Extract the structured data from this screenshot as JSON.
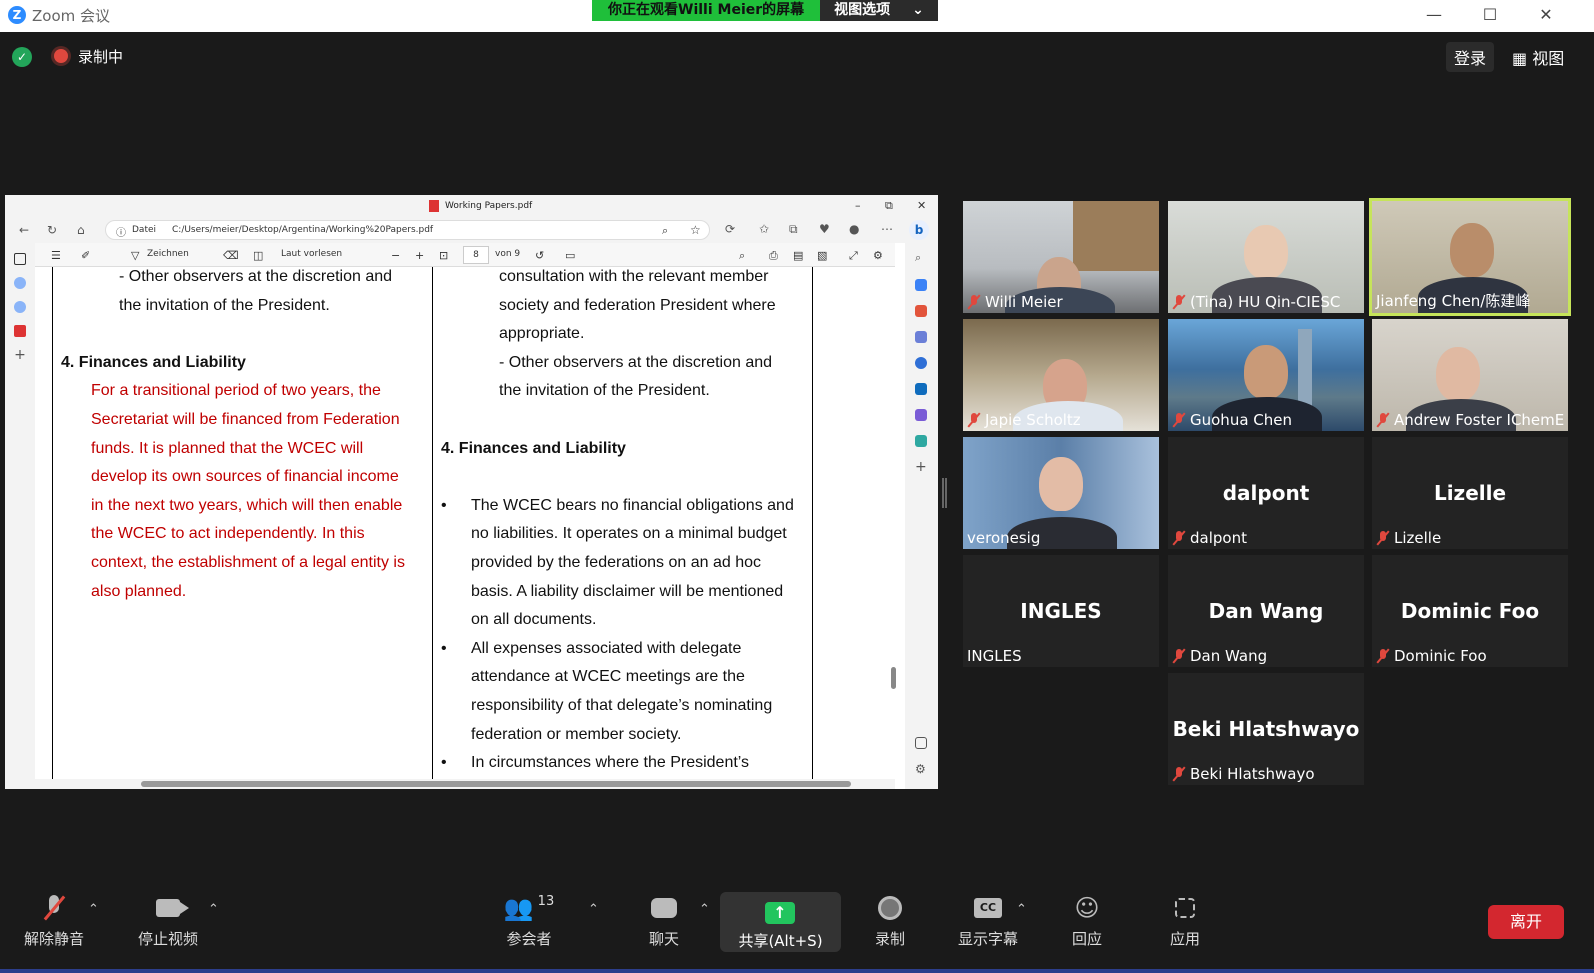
{
  "window": {
    "app_title": "Zoom 会议",
    "minimize": "—",
    "maximize": "☐",
    "close": "✕"
  },
  "share_banner": {
    "viewing_text": "你正在观看Willi  Meier的屏幕",
    "view_options": "视图选项",
    "chevron": "⌄"
  },
  "topbar": {
    "recording_label": "录制中",
    "login": "登录",
    "view": "视图"
  },
  "browser": {
    "tab_title": "Working Papers.pdf",
    "datei": "Datei",
    "url": "C:/Users/meier/Desktop/Argentina/Working%20Papers.pdf",
    "zeichnen": "Zeichnen",
    "laut_vorlesen": "Laut vorlesen",
    "page_current": "8",
    "page_total": "von 9"
  },
  "document": {
    "left_col": {
      "line1": "- Other observers at the discretion and",
      "line2": "the invitation of the President.",
      "heading": "4. Finances and Liability",
      "red_lines": [
        "For a transitional period of two years, the",
        "Secretariat will be financed from Federation",
        "funds. It is planned that the WCEC will",
        "develop its own sources of financial income",
        "in the next two years, which will then enable",
        "the WCEC to act independently. In this",
        "context, the establishment of a legal entity is",
        "also planned."
      ]
    },
    "right_col": {
      "top_lines": [
        "consultation with the relevant member",
        "society and federation President where",
        "appropriate.",
        "- Other observers at the discretion and",
        "the invitation of the President."
      ],
      "heading": "4. Finances and Liability",
      "bullet1": [
        "The WCEC bears no financial obligations and",
        "no liabilities.  It operates on a minimal budget",
        "provided by the federations on an ad hoc",
        "basis.  A liability disclaimer will be mentioned",
        "on all documents."
      ],
      "bullet2": [
        "All expenses associated with delegate",
        "attendance at WCEC meetings are the",
        "responsibility of that delegate’s nominating",
        "federation or member society."
      ],
      "bullet3": [
        "In circumstances where the President’s"
      ],
      "bullet_glyph": "•"
    }
  },
  "participants": [
    {
      "name": "Willi Meier",
      "muted": true,
      "video": true,
      "active": false
    },
    {
      "name": "(Tina) HU Qin-CIESC",
      "muted": true,
      "video": true,
      "active": false
    },
    {
      "name": "Jianfeng Chen/陈建峰",
      "muted": false,
      "video": true,
      "active": true
    },
    {
      "name": "Japie Scholtz",
      "muted": true,
      "video": true,
      "active": false
    },
    {
      "name": "Guohua Chen",
      "muted": true,
      "video": true,
      "active": false
    },
    {
      "name": "Andrew Foster IChemE",
      "muted": true,
      "video": true,
      "active": false
    },
    {
      "name": "veronesig",
      "muted": false,
      "video": true,
      "active": false
    },
    {
      "name": "dalpont",
      "big": "dalpont",
      "muted": true,
      "video": false,
      "active": false
    },
    {
      "name": "Lizelle",
      "big": "Lizelle",
      "muted": true,
      "video": false,
      "active": false
    },
    {
      "name": "INGLES",
      "big": "INGLES",
      "muted": false,
      "video": false,
      "active": false
    },
    {
      "name": "Dan Wang",
      "big": "Dan Wang",
      "muted": true,
      "video": false,
      "active": false
    },
    {
      "name": "Dominic Foo",
      "big": "Dominic Foo",
      "muted": true,
      "video": false,
      "active": false
    },
    {
      "name": "Beki Hlatshwayo",
      "big": "Beki Hlatshwayo",
      "muted": true,
      "video": false,
      "active": false
    }
  ],
  "toolbar": {
    "unmute": "解除静音",
    "stop_video": "停止视频",
    "participants": "参会者",
    "participants_count": "13",
    "chat": "聊天",
    "share": "共享(Alt+S)",
    "record": "录制",
    "captions": "显示字幕",
    "captions_icon": "CC",
    "reactions": "回应",
    "apps": "应用",
    "leave": "离开",
    "caret": "⌃"
  },
  "colors": {
    "zoom_blue": "#2d8cff",
    "banner_green": "#1fbf3a",
    "mute_red": "#e0483e",
    "leave_red": "#d3272f",
    "active_speaker": "#c6e45a",
    "doc_red": "#c00000"
  }
}
